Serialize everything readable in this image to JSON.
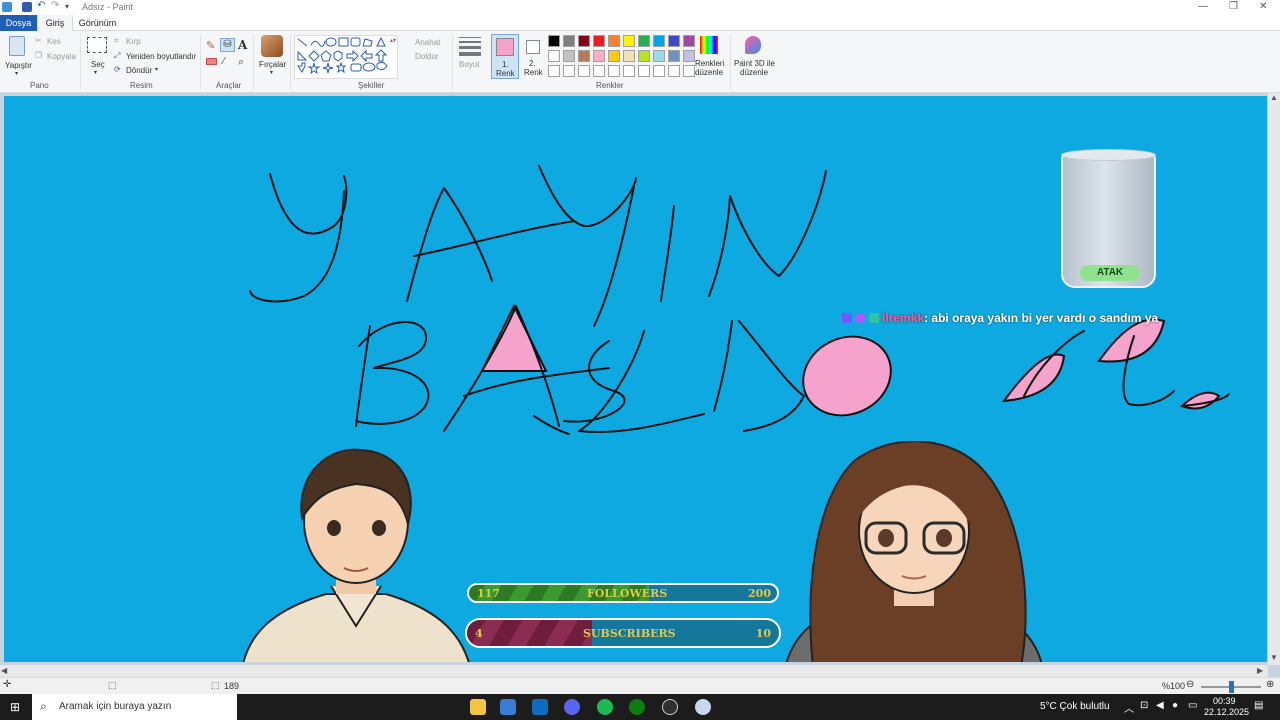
{
  "window": {
    "title": "Adsız - Paint"
  },
  "menu": {
    "tabs": [
      "Dosya",
      "Giriş",
      "Görünüm"
    ]
  },
  "ribbon": {
    "clipboard": {
      "paste": "Yapıştır",
      "cut": "Kes",
      "copy": "Kopyala",
      "group": "Pano"
    },
    "image": {
      "select": "Seç",
      "crop": "Kırp",
      "resize": "Yeniden boyutlandır",
      "rotate": "Döndür",
      "group": "Resim"
    },
    "tools": {
      "group": "Araçlar"
    },
    "brushes": {
      "label": "Fırçalar"
    },
    "shapes": {
      "outline": "Anahat",
      "fill": "Doldur",
      "group": "Şekiller"
    },
    "size": {
      "label": "Boyut"
    },
    "colors": {
      "color1_label": "1.",
      "color1_sub": "Renk",
      "color2_label": "2.",
      "color2_sub": "Renk",
      "color1": "#f6a3cc",
      "color2": "#ffffff",
      "edit_colors": "Renkleri",
      "edit_colors_sub": "düzenle",
      "group": "Renkler",
      "palette_row1": [
        "#000000",
        "#7f7f7f",
        "#880015",
        "#ed1c24",
        "#ff7f27",
        "#fff200",
        "#22b14c",
        "#00a2e8",
        "#3f48cc",
        "#a349a4"
      ],
      "palette_row2": [
        "#ffffff",
        "#c3c3c3",
        "#b97a57",
        "#ffaec9",
        "#ffc90e",
        "#efe4b0",
        "#b5e61d",
        "#99d9ea",
        "#7092be",
        "#c8bfe7"
      ]
    },
    "paint3d": {
      "label": "Paint 3D ile",
      "label2": "düzenle"
    }
  },
  "canvas": {
    "background": "#0fa9e2",
    "handwriting": [
      "YAYIN",
      "BAŞLIYOORRR.."
    ],
    "chat": {
      "user": "Ilremkk",
      "message": ": abi oraya yakın bi yer vardı o sandım ya"
    },
    "glass_text": "ATAK",
    "followers": {
      "current": "117",
      "label": "FOLLOWERS",
      "goal": "200",
      "fraction": 0.585
    },
    "subscribers": {
      "current": "4",
      "label": "SUBSCRIBERS",
      "goal": "10",
      "fraction": 0.4
    }
  },
  "statusbar": {
    "zoom": "%100",
    "size_partial": "189"
  },
  "taskbar": {
    "search_placeholder": "Aramak için buraya yazın",
    "weather": "5°C  Çok bulutlu",
    "time": "00:39",
    "date": "22.12.2025"
  }
}
